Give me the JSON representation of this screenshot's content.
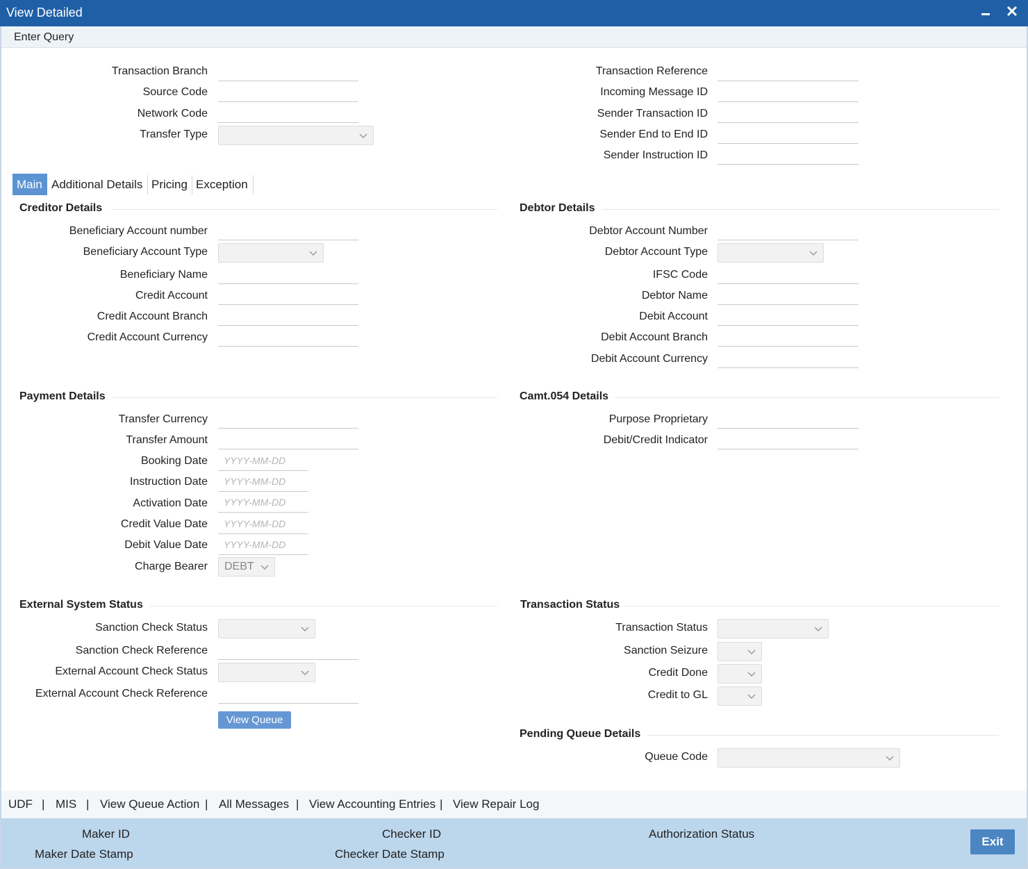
{
  "window": {
    "title": "View Detailed"
  },
  "menu": {
    "enter_query": "Enter Query"
  },
  "query": {
    "transaction_branch": "Transaction Branch",
    "source_code": "Source Code",
    "network_code": "Network Code",
    "transfer_type": "Transfer Type",
    "transaction_reference": "Transaction Reference",
    "incoming_message_id": "Incoming Message ID",
    "sender_transaction_id": "Sender Transaction ID",
    "sender_end_to_end_id": "Sender End to End ID",
    "sender_instruction_id": "Sender Instruction ID"
  },
  "tabs": [
    {
      "label": "Main"
    },
    {
      "label": "Additional Details"
    },
    {
      "label": "Pricing"
    },
    {
      "label": "Exception"
    }
  ],
  "creditor": {
    "heading": "Creditor Details",
    "beneficiary_account_number": "Beneficiary Account number",
    "beneficiary_account_type": "Beneficiary Account Type",
    "beneficiary_name": "Beneficiary Name",
    "credit_account": "Credit Account",
    "credit_account_branch": "Credit Account Branch",
    "credit_account_currency": "Credit Account Currency"
  },
  "debtor": {
    "heading": "Debtor Details",
    "debtor_account_number": "Debtor Account Number",
    "debtor_account_type": "Debtor Account Type",
    "ifsc_code": "IFSC Code",
    "debtor_name": "Debtor Name",
    "debit_account": "Debit Account",
    "debit_account_branch": "Debit Account Branch",
    "debit_account_currency": "Debit Account Currency"
  },
  "payment": {
    "heading": "Payment Details",
    "transfer_currency": "Transfer Currency",
    "transfer_amount": "Transfer Amount",
    "booking_date": "Booking Date",
    "instruction_date": "Instruction Date",
    "activation_date": "Activation Date",
    "credit_value_date": "Credit Value Date",
    "debit_value_date": "Debit Value Date",
    "charge_bearer": "Charge Bearer",
    "charge_bearer_value": "DEBT",
    "date_placeholder": "YYYY-MM-DD"
  },
  "camt": {
    "heading": "Camt.054 Details",
    "purpose_proprietary": "Purpose Proprietary",
    "debit_credit_indicator": "Debit/Credit Indicator"
  },
  "external": {
    "heading": "External System Status",
    "sanction_check_status": "Sanction Check Status",
    "sanction_check_reference": "Sanction Check Reference",
    "external_account_check_status": "External Account Check Status",
    "external_account_check_reference": "External Account Check Reference",
    "view_queue": "View Queue"
  },
  "txn_status": {
    "heading": "Transaction Status",
    "transaction_status": "Transaction Status",
    "sanction_seizure": "Sanction Seizure",
    "credit_done": "Credit Done",
    "credit_to_gl": "Credit to GL"
  },
  "pending": {
    "heading": "Pending Queue Details",
    "queue_code": "Queue Code"
  },
  "links": [
    {
      "label": "UDF"
    },
    {
      "label": "MIS"
    },
    {
      "label": "View Queue Action"
    },
    {
      "label": "All Messages"
    },
    {
      "label": "View Accounting Entries"
    },
    {
      "label": "View Repair Log"
    }
  ],
  "footer": {
    "maker_id": "Maker ID",
    "maker_date_stamp": "Maker Date Stamp",
    "checker_id": "Checker ID",
    "checker_date_stamp": "Checker Date Stamp",
    "authorization_status": "Authorization Status",
    "exit": "Exit"
  },
  "colors": {
    "titlebar": "#1f5fa6",
    "tab_active": "#5b93d3",
    "footer": "#bcd6ec",
    "button": "#6597d4"
  }
}
